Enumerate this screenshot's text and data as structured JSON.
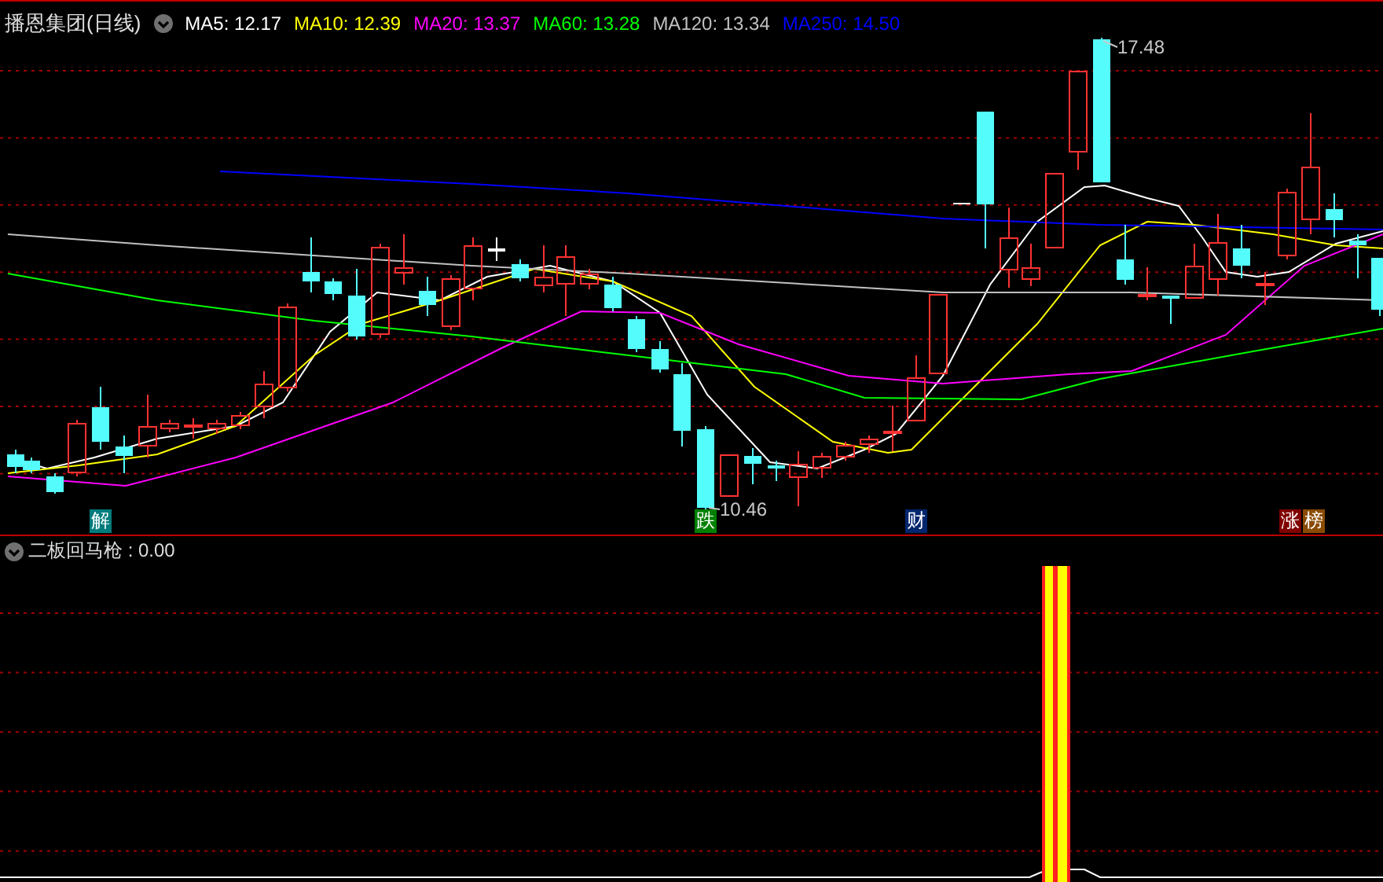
{
  "title": "播恩集团(日线)",
  "ma_legend": [
    {
      "label": "MA5: 12.17",
      "color": "#ffffff"
    },
    {
      "label": "MA10: 12.39",
      "color": "#ffff00"
    },
    {
      "label": "MA20: 13.37",
      "color": "#ff00ff"
    },
    {
      "label": "MA60: 13.28",
      "color": "#00ff00"
    },
    {
      "label": "MA120: 13.34",
      "color": "#c0c0c0"
    },
    {
      "label": "MA250: 14.50",
      "color": "#0000ff"
    }
  ],
  "price_labels": [
    {
      "kind": "high",
      "text": "17.48"
    },
    {
      "kind": "low",
      "text": "10.46"
    }
  ],
  "markers": [
    {
      "text": "解",
      "color": "#007c7c"
    },
    {
      "text": "跌",
      "color": "#008000"
    },
    {
      "text": "财",
      "color": "#00266e"
    },
    {
      "text": "涨",
      "color": "#800000"
    },
    {
      "text": "榜",
      "color": "#8a4a00"
    }
  ],
  "indicator": {
    "title": "二板回马枪 : 0.00"
  }
}
